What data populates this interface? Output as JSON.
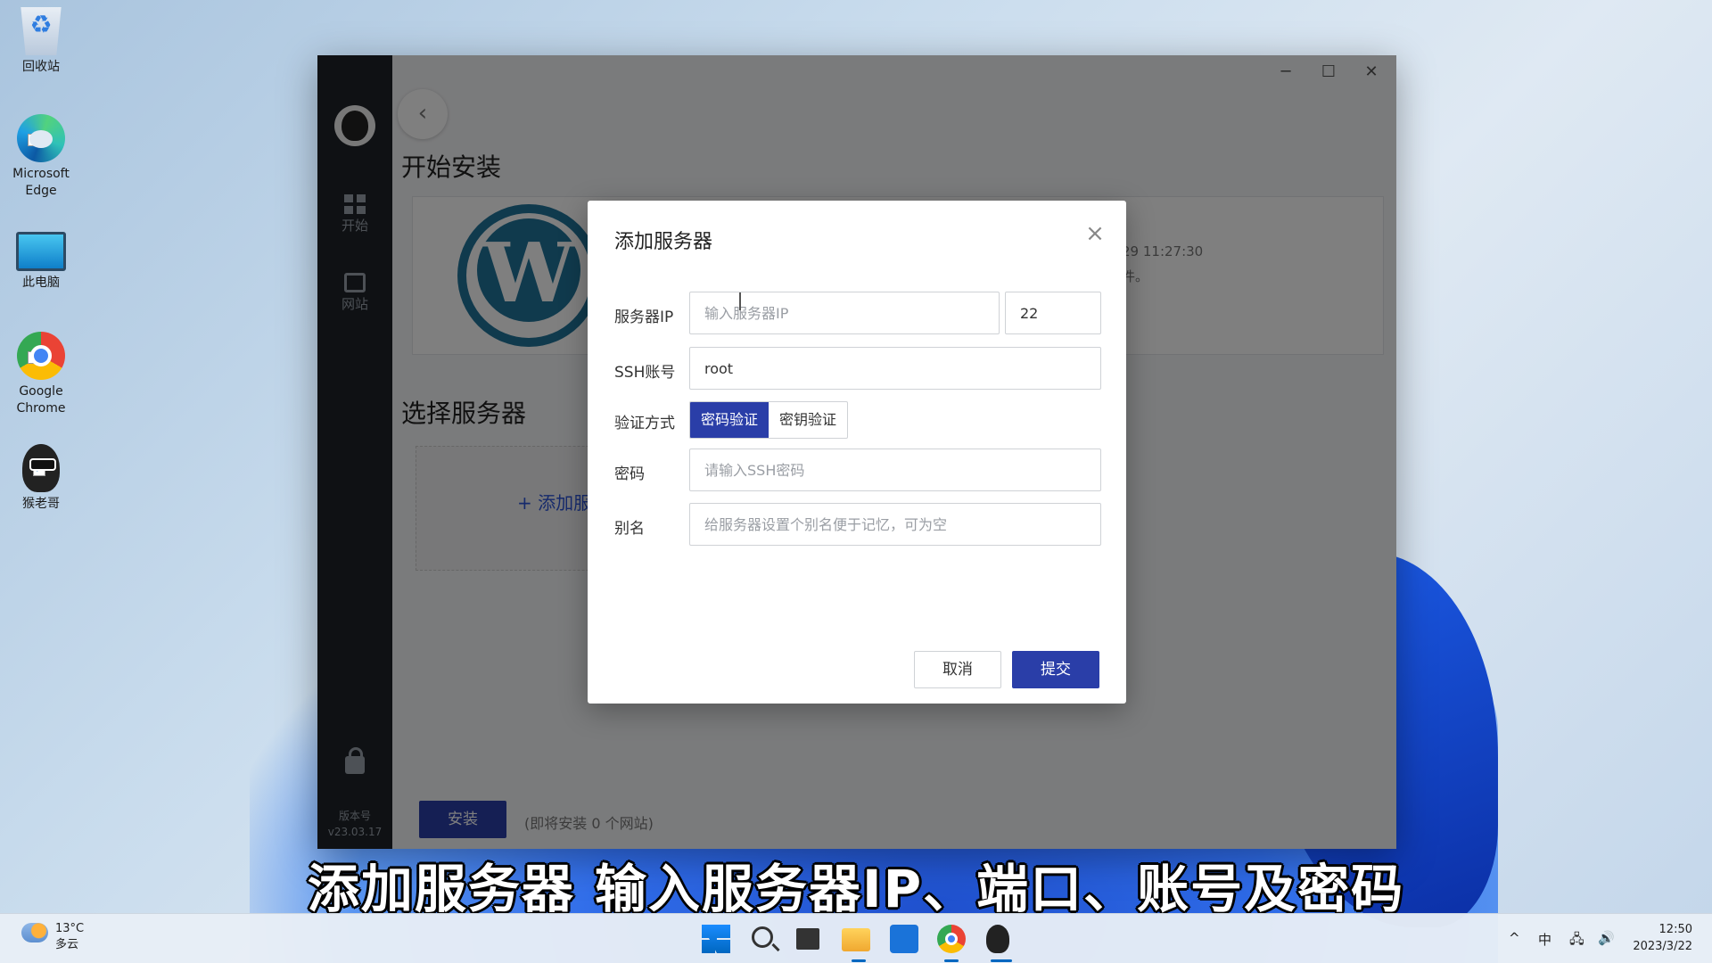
{
  "desktop": {
    "icons": [
      {
        "label": "回收站"
      },
      {
        "label": "Microsoft Edge"
      },
      {
        "label": "此电脑"
      },
      {
        "label": "Google Chrome"
      },
      {
        "label": "猴老哥"
      }
    ]
  },
  "app": {
    "nav": [
      {
        "label": "开始"
      },
      {
        "label": "网站"
      }
    ],
    "version_label": "版本号",
    "version_value": "v23.03.17",
    "window_controls": {
      "minimize": "─",
      "maximize": "☐",
      "close": "✕"
    },
    "back": "‹",
    "section_install": "开始安装",
    "section_server": "选择服务器",
    "card_meta_line1": "29 11:27:30",
    "card_meta_line2": "件。",
    "add_server": "+ 添加服",
    "install_button": "安装",
    "install_note": "(即将安装 0 个网站)"
  },
  "modal": {
    "title": "添加服务器",
    "close": "×",
    "fields": {
      "ip_label": "服务器IP",
      "ip_placeholder": "输入服务器IP",
      "port_value": "22",
      "ssh_label": "SSH账号",
      "ssh_value": "root",
      "auth_label": "验证方式",
      "auth_options": [
        "密码验证",
        "密钥验证"
      ],
      "auth_selected": "密码验证",
      "password_label": "密码",
      "password_placeholder": "请输入SSH密码",
      "alias_label": "别名",
      "alias_placeholder": "给服务器设置个别名便于记忆，可为空"
    },
    "cancel": "取消",
    "submit": "提交"
  },
  "subtitle": "添加服务器 输入服务器IP、端口、账号及密码",
  "taskbar": {
    "weather_temp": "13°C",
    "weather_desc": "多云",
    "tray": {
      "chevron": "^",
      "ime": "中",
      "network": "🖧",
      "volume": "🔊"
    },
    "time": "12:50",
    "date": "2023/3/22"
  }
}
